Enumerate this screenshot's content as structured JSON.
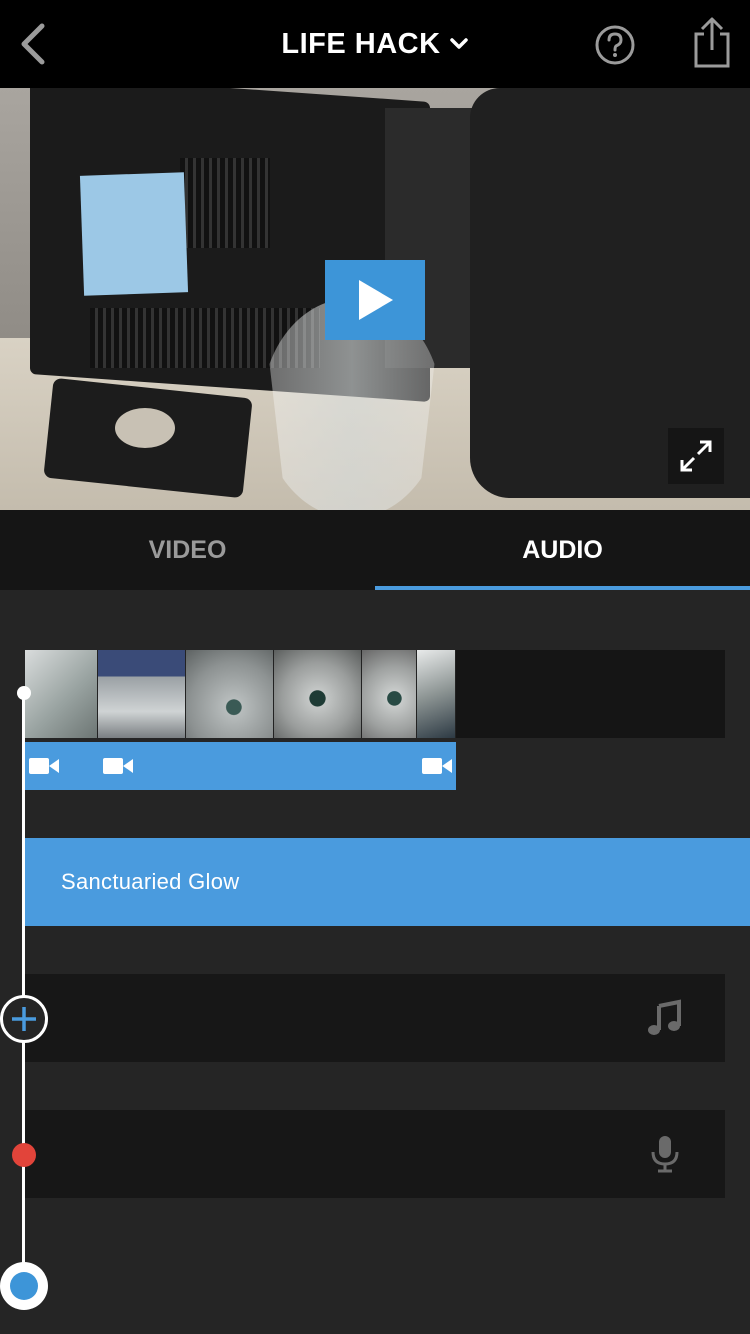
{
  "header": {
    "title": "LIFE HACK",
    "back_icon": "chevron-left-icon",
    "title_dropdown_icon": "chevron-down-icon",
    "help_icon": "help-circle-icon",
    "share_icon": "share-icon"
  },
  "preview": {
    "play_icon": "play-icon",
    "fullscreen_icon": "expand-icon"
  },
  "tabs": [
    {
      "label": "VIDEO",
      "active": false
    },
    {
      "label": "AUDIO",
      "active": true
    }
  ],
  "timeline": {
    "video_clips": [
      {
        "icon": "video-camera-icon"
      },
      {
        "icon": "video-camera-icon"
      },
      {
        "icon": "video-camera-icon"
      }
    ],
    "music_track": {
      "label": "Sanctuaried Glow",
      "color": "#4a9bde"
    },
    "music_add_icon": "music-note-icon",
    "voiceover_icon": "microphone-icon",
    "add_icon": "plus-icon",
    "accent": "#4a9bde",
    "record_color": "#e2443a"
  }
}
